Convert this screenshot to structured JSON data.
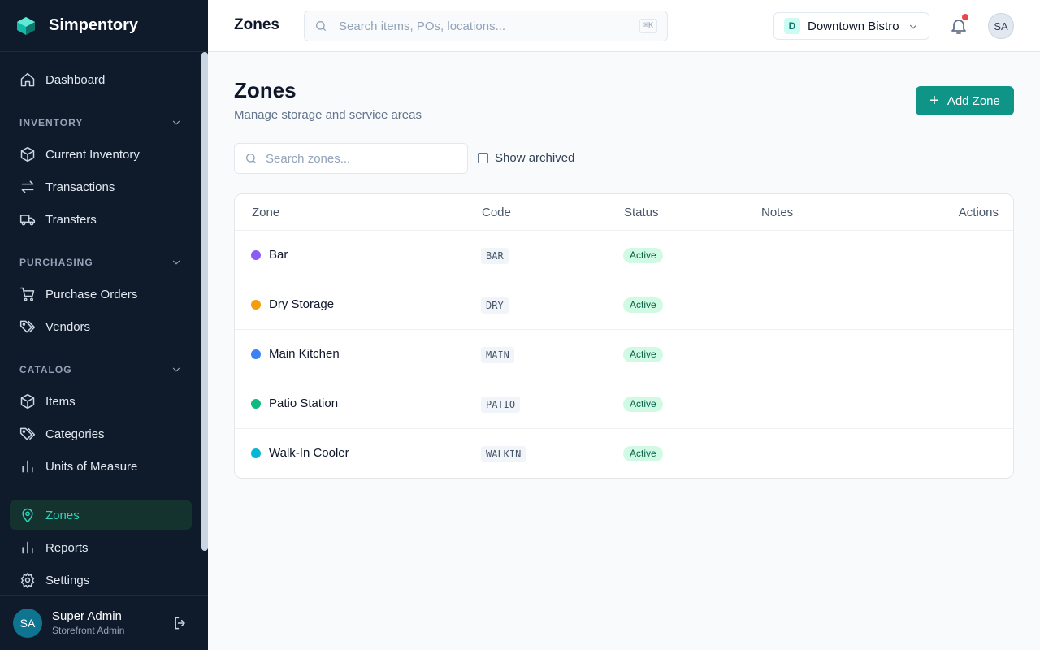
{
  "brand": {
    "name": "Simpentory"
  },
  "nav": {
    "dashboard": "Dashboard",
    "inventory_section": "INVENTORY",
    "current_inventory": "Current Inventory",
    "transactions": "Transactions",
    "transfers": "Transfers",
    "purchasing_section": "PURCHASING",
    "purchase_orders": "Purchase Orders",
    "vendors": "Vendors",
    "catalog_section": "CATALOG",
    "items": "Items",
    "categories": "Categories",
    "units": "Units of Measure",
    "zones": "Zones",
    "reports": "Reports",
    "settings": "Settings"
  },
  "user": {
    "initials": "SA",
    "name": "Super Admin",
    "role": "Storefront Admin"
  },
  "topbar": {
    "title": "Zones",
    "search_placeholder": "Search items, POs, locations...",
    "shortcut": "⌘K",
    "location_initial": "D",
    "location_name": "Downtown Bistro",
    "avatar_initials": "SA"
  },
  "page": {
    "title": "Zones",
    "subtitle": "Manage storage and service areas",
    "add_button": "Add Zone",
    "search_placeholder": "Search zones...",
    "show_archived": "Show archived"
  },
  "table": {
    "headers": {
      "zone": "Zone",
      "code": "Code",
      "status": "Status",
      "notes": "Notes",
      "actions": "Actions"
    },
    "rows": [
      {
        "name": "Bar",
        "code": "BAR",
        "status": "Active",
        "color": "#8b5cf6"
      },
      {
        "name": "Dry Storage",
        "code": "DRY",
        "status": "Active",
        "color": "#f59e0b"
      },
      {
        "name": "Main Kitchen",
        "code": "MAIN",
        "status": "Active",
        "color": "#3b82f6"
      },
      {
        "name": "Patio Station",
        "code": "PATIO",
        "status": "Active",
        "color": "#10b981"
      },
      {
        "name": "Walk-In Cooler",
        "code": "WALKIN",
        "status": "Active",
        "color": "#06b6d4"
      }
    ]
  },
  "colors": {
    "accent": "#0f9488",
    "sidebar": "#0f1a2b",
    "active_nav_text": "#2dd4bf"
  }
}
